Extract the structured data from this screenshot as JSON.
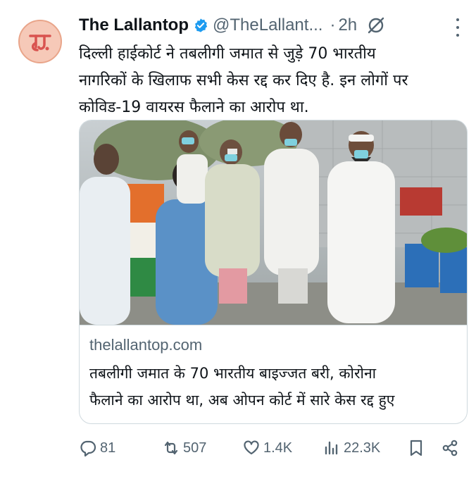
{
  "author": {
    "name": "The Lallantop",
    "handle": "@TheLallant...",
    "separator": "·",
    "time": "2h"
  },
  "tweet": {
    "lines": [
      "दिल्ली हाईकोर्ट ने तबलीगी जमात से जुड़े 70 भारतीय",
      "नागरिकों के खिलाफ सभी केस रद्द कर दिए है. इन लोगों पर",
      "कोविड-19 वायरस फैलाने का आरोप था."
    ]
  },
  "card": {
    "domain": "thelallantop.com",
    "title_lines": [
      "तबलीगी जमात के 70 भारतीय बाइज्जत बरी, कोरोना",
      "फैलाने का आरोप था, अब ओपन कोर्ट में सारे केस रद्द हुए"
    ]
  },
  "actions": {
    "replies": "81",
    "reposts": "507",
    "likes": "1.4K",
    "views": "22.3K"
  },
  "colors": {
    "text": "#0f1419",
    "secondary": "#536471",
    "verified": "#1d9bf0",
    "avatar_bg": "#f6c9b8"
  },
  "icons": [
    "verified-badge-icon",
    "grok-icon",
    "more-icon",
    "reply-icon",
    "repost-icon",
    "like-icon",
    "views-icon",
    "bookmark-icon",
    "share-icon"
  ]
}
